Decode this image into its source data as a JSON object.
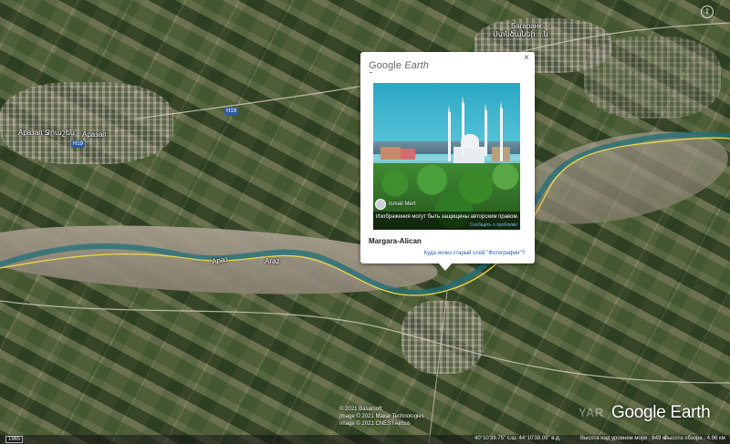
{
  "popup": {
    "brand_google": "Google",
    "brand_earth": "Earth",
    "close_label": "×",
    "photo_author": "Ismail Mert",
    "photo_copyright": "Изображения могут быть защищены авторским правом.",
    "report_link": "Сообщить о проблеме",
    "photo_title": "Margara-Alican",
    "help_link": "Куда исчез старый слой \"Фотографии\"?"
  },
  "map": {
    "labels": {
      "town_top_right": "Багаранк",
      "town_top_right_sub": "Ստնծանեի ...ն",
      "town_left_1": "Аразап Ջրաշեն",
      "town_left_2": "Аразап",
      "river_left": "Араз",
      "river_mid": "Araz"
    },
    "road_shields": {
      "h1": "H19",
      "h2": "H19"
    }
  },
  "attribution": {
    "line1": "© 2021 Basarsoft",
    "line2": "Image © 2021 Maxar Technologies",
    "line3": "Image © 2021 CNES / Airbus"
  },
  "wordmark": "Google Earth",
  "wordmark_ghost": "YAR",
  "status_bar": {
    "scale": "1965",
    "coordinates": "40°10'39.75\" с.ш. 44°10'38.09\" в.д.",
    "elevation": "Высота над уровнем моря : 849 м",
    "eye_alt": "Высота обзора : 4.96 км"
  },
  "nav": {
    "arrow": "⇧"
  }
}
